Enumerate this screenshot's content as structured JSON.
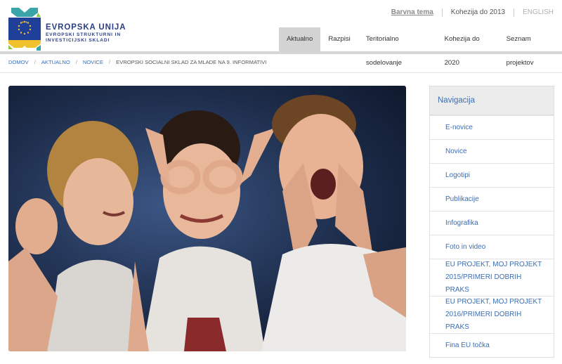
{
  "logo": {
    "title": "EVROPSKA UNIJA",
    "subtitle_line1": "EVROPSKI STRUKTURNI IN",
    "subtitle_line2": "INVESTICIJSKI SKLADI",
    "colors": {
      "blue": "#2b3e85",
      "teal": "#3aa4a8",
      "yellow": "#f2c12e",
      "green": "#8dc63f",
      "flag_blue": "#1f3f99"
    }
  },
  "util_nav": [
    {
      "label": "Barvna tema"
    },
    {
      "label": "Kohezija do 2013"
    },
    {
      "label": "ENGLISH"
    }
  ],
  "main_nav": {
    "items": [
      {
        "label": "Aktualno",
        "active": true
      },
      {
        "label": "Razpisi"
      },
      {
        "label": "Teritorialno sodelovanje"
      },
      {
        "label": "Kohezija do 2020"
      },
      {
        "label": "Seznam projektov"
      }
    ]
  },
  "breadcrumb": {
    "items": [
      "DOMOV",
      "AKTUALNO",
      "NOVICE",
      "EVROPSKI SOCIALNI SKLAD ZA MLADE NA 9. INFORMATIVI"
    ],
    "separator": "/"
  },
  "sidebar": {
    "heading": "Navigacija",
    "items": [
      {
        "label": "E-novice"
      },
      {
        "label": "Novice"
      },
      {
        "label": "Logotipi"
      },
      {
        "label": "Publikacije"
      },
      {
        "label": "Infografika"
      },
      {
        "label": "Foto in video"
      },
      {
        "label": "EU PROJEKT, MOJ PROJEKT 2015/PRIMERI DOBRIH PRAKS"
      },
      {
        "label": "EU PROJEKT, MOJ PROJEKT 2016/PRIMERI DOBRIH PRAKS"
      },
      {
        "label": "Fina EU točka"
      }
    ],
    "colors": {
      "link": "#3b6eb4",
      "heading_bg": "#ececec"
    }
  },
  "colors": {
    "accent": "#3b6eb4",
    "nav_active_bg": "#d3d3d3",
    "rule": "#d6d6d6"
  }
}
